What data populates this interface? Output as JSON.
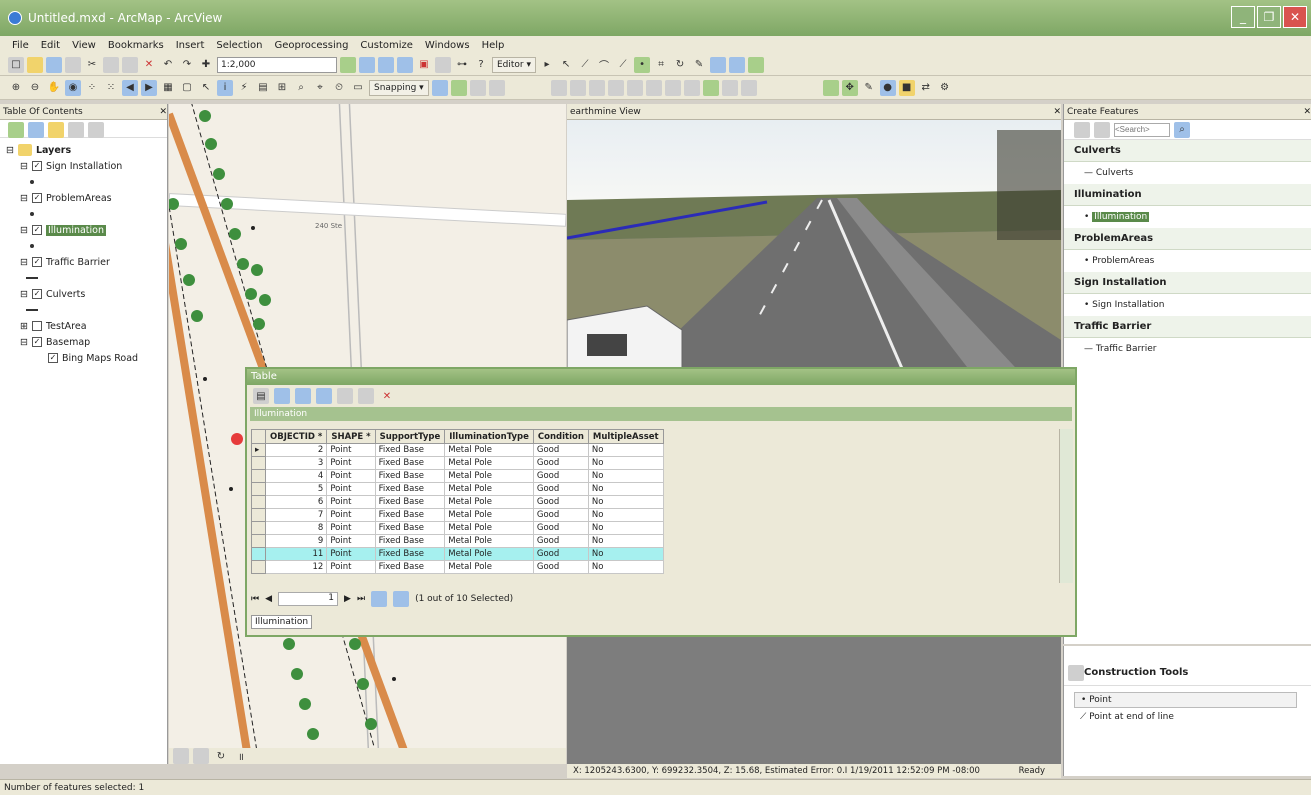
{
  "window": {
    "title": "Untitled.mxd - ArcMap - ArcView"
  },
  "menu": [
    "File",
    "Edit",
    "View",
    "Bookmarks",
    "Insert",
    "Selection",
    "Geoprocessing",
    "Customize",
    "Windows",
    "Help"
  ],
  "toolbar": {
    "scale": "1:2,000",
    "editor_label": "Editor ▾",
    "snapping_label": "Snapping ▾"
  },
  "toc": {
    "title": "Table Of Contents",
    "root": "Layers",
    "layers": [
      {
        "label": "Sign Installation",
        "checked": true,
        "symbol": "dot"
      },
      {
        "label": "ProblemAreas",
        "checked": true,
        "symbol": "dot"
      },
      {
        "label": "Illumination",
        "checked": true,
        "symbol": "dot",
        "selected": true
      },
      {
        "label": "Traffic Barrier",
        "checked": true,
        "symbol": "line"
      },
      {
        "label": "Culverts",
        "checked": true,
        "symbol": "line"
      },
      {
        "label": "TestArea",
        "checked": false
      },
      {
        "label": "Basemap",
        "checked": true
      },
      {
        "label": "Bing Maps Road",
        "checked": true,
        "indent": true
      }
    ]
  },
  "map": {
    "street_label": "240 Ste"
  },
  "earthmine": {
    "title": "earthmine View"
  },
  "create_features": {
    "title": "Create Features",
    "search_placeholder": "<Search>",
    "groups": [
      {
        "name": "Culverts",
        "items": [
          "Culverts"
        ]
      },
      {
        "name": "Illumination",
        "items": [
          "Illumination"
        ],
        "selected": true
      },
      {
        "name": "ProblemAreas",
        "items": [
          "ProblemAreas"
        ]
      },
      {
        "name": "Sign Installation",
        "items": [
          "Sign Installation"
        ]
      },
      {
        "name": "Traffic Barrier",
        "items": [
          "Traffic Barrier"
        ]
      }
    ]
  },
  "construction_tools": {
    "title": "Construction Tools",
    "items": [
      "Point",
      "Point at end of line"
    ]
  },
  "table": {
    "window_title": "Table",
    "layer_name": "Illumination",
    "columns": [
      "OBJECTID *",
      "SHAPE *",
      "SupportType",
      "IlluminationType",
      "Condition",
      "MultipleAsset"
    ],
    "rows": [
      [
        "2",
        "Point",
        "Fixed Base",
        "Metal Pole",
        "Good",
        "No"
      ],
      [
        "3",
        "Point",
        "Fixed Base",
        "Metal Pole",
        "Good",
        "No"
      ],
      [
        "4",
        "Point",
        "Fixed Base",
        "Metal Pole",
        "Good",
        "No"
      ],
      [
        "5",
        "Point",
        "Fixed Base",
        "Metal Pole",
        "Good",
        "No"
      ],
      [
        "6",
        "Point",
        "Fixed Base",
        "Metal Pole",
        "Good",
        "No"
      ],
      [
        "7",
        "Point",
        "Fixed Base",
        "Metal Pole",
        "Good",
        "No"
      ],
      [
        "8",
        "Point",
        "Fixed Base",
        "Metal Pole",
        "Good",
        "No"
      ],
      [
        "9",
        "Point",
        "Fixed Base",
        "Metal Pole",
        "Good",
        "No"
      ],
      [
        "11",
        "Point",
        "Fixed Base",
        "Metal Pole",
        "Good",
        "No"
      ],
      [
        "12",
        "Point",
        "Fixed Base",
        "Metal Pole",
        "Good",
        "No"
      ]
    ],
    "highlight_row": 8,
    "nav_record": "1",
    "selection_text": "(1 out of 10 Selected)",
    "tab_label": "Illumination"
  },
  "status": {
    "coords": "X: 1205243.6300, Y: 699232.3504, Z: 15.68, Estimated Error: 0.I 1/19/2011 12:52:09 PM -08:00",
    "ready": "Ready",
    "bottom": "Number of features selected: 1"
  },
  "colors": {
    "titlebar": "#7ea765",
    "highlight": "#a6f0ef",
    "road": "#d98b4a",
    "trees": "#3e8f3e"
  }
}
